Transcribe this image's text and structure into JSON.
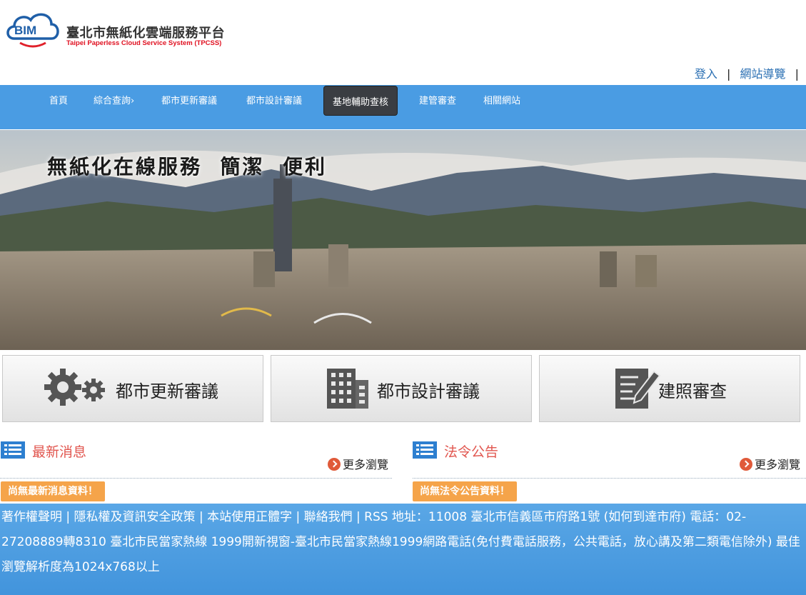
{
  "logo": {
    "abbr": "BIM",
    "title": "臺北市無紙化雲端服務平台",
    "subtitle": "Taipei Paperless Cloud Service System (TPCSS)"
  },
  "toplinks": {
    "login": "登入",
    "sitemap": "網站導覽",
    "sep": "|"
  },
  "nav": {
    "items": [
      "首頁",
      "綜合查詢›",
      "都市更新審議",
      "都市設計審議",
      "基地輔助查核",
      "建管審查",
      "相關網站"
    ]
  },
  "banner": {
    "title": "無紙化在線服務  簡潔  便利"
  },
  "cards": [
    {
      "label": "都市更新審議",
      "icon": "gears-icon"
    },
    {
      "label": "都市設計審議",
      "icon": "building-icon"
    },
    {
      "label": "建照審查",
      "icon": "edit-document-icon"
    }
  ],
  "news": {
    "title": "最新消息",
    "more": "更多瀏覽",
    "empty": "尚無最新消息資料！"
  },
  "laws": {
    "title": "法令公告",
    "more": "更多瀏覽",
    "empty": "尚無法令公告資料！"
  },
  "footer": {
    "text": "著作權聲明 | 隱私權及資訊安全政策 | 本站使用正體字 | 聯絡我們 | RSS 地址：11008 臺北市信義區市府路1號 (如何到達市府) 電話：02-27208889轉8310 臺北市民當家熱線 1999開新視窗-臺北市民當家熱線1999網路電話(免付費電話服務，公共電話，放心講及第二類電信除外) 最佳瀏覽解析度為1024x768以上"
  },
  "colors": {
    "nav": "#4a9ce3",
    "active_nav": "#3a3d42",
    "section_title": "#e1564f",
    "badge": "#f5a44a",
    "footer": "#4a9ce3"
  }
}
